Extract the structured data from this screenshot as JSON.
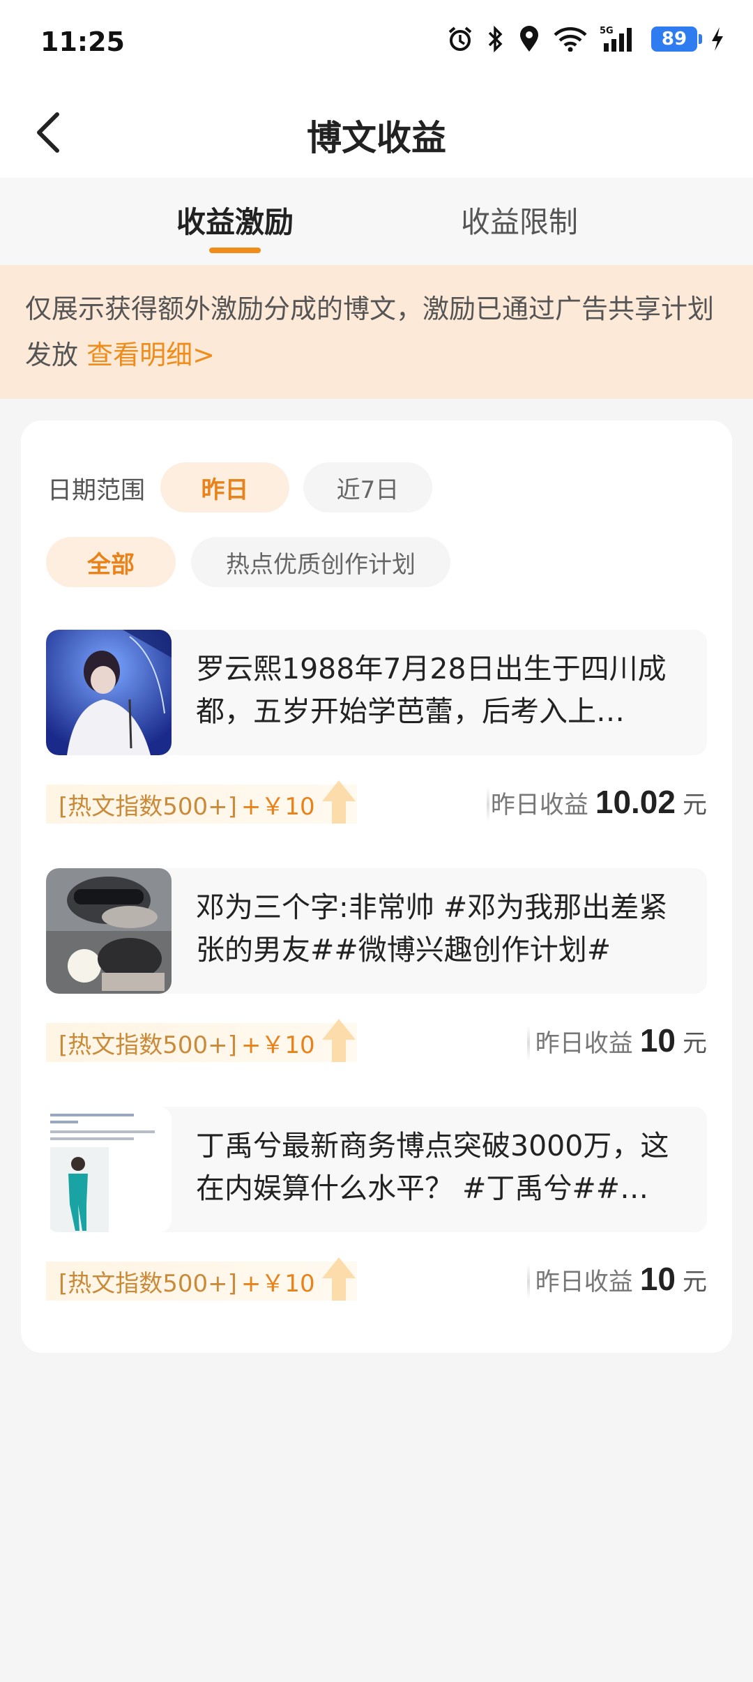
{
  "status": {
    "time": "11:25",
    "battery": "89",
    "network": "5G"
  },
  "nav": {
    "title": "博文收益"
  },
  "tabs": [
    {
      "label": "收益激励",
      "active": true
    },
    {
      "label": "收益限制",
      "active": false
    }
  ],
  "notice": {
    "text": "仅展示获得额外激励分成的博文，激励已通过广告共享计划发放 ",
    "link": "查看明细>"
  },
  "filters": {
    "date_label": "日期范围",
    "date_options": [
      {
        "label": "昨日",
        "selected": true
      },
      {
        "label": "近7日",
        "selected": false
      }
    ],
    "plan_options": [
      {
        "label": "全部",
        "selected": true
      },
      {
        "label": "热点优质创作计划",
        "selected": false
      }
    ]
  },
  "posts": [
    {
      "text": "罗云熙1988年7月28日出生于四川成都，五岁开始学芭蕾，后考入上…",
      "badge": "[热文指数500+]",
      "bonus": "+￥10",
      "earn_label": "昨日收益",
      "earn_value": "10.02",
      "earn_unit": "元"
    },
    {
      "text": "邓为三个字:非常帅 #邓为我那出差紧张的男友##微博兴趣创作计划#",
      "badge": "[热文指数500+]",
      "bonus": "+￥10",
      "earn_label": "昨日收益",
      "earn_value": "10",
      "earn_unit": "元"
    },
    {
      "text": "丁禹兮最新商务博点突破3000万，这在内娱算什么水平？ #丁禹兮##…",
      "badge": "[热文指数500+]",
      "bonus": "+￥10",
      "earn_label": "昨日收益",
      "earn_value": "10",
      "earn_unit": "元"
    }
  ],
  "colors": {
    "accent": "#f08c1a",
    "notice_bg": "#fde9d8",
    "chip_on_bg": "#fdeedf"
  }
}
